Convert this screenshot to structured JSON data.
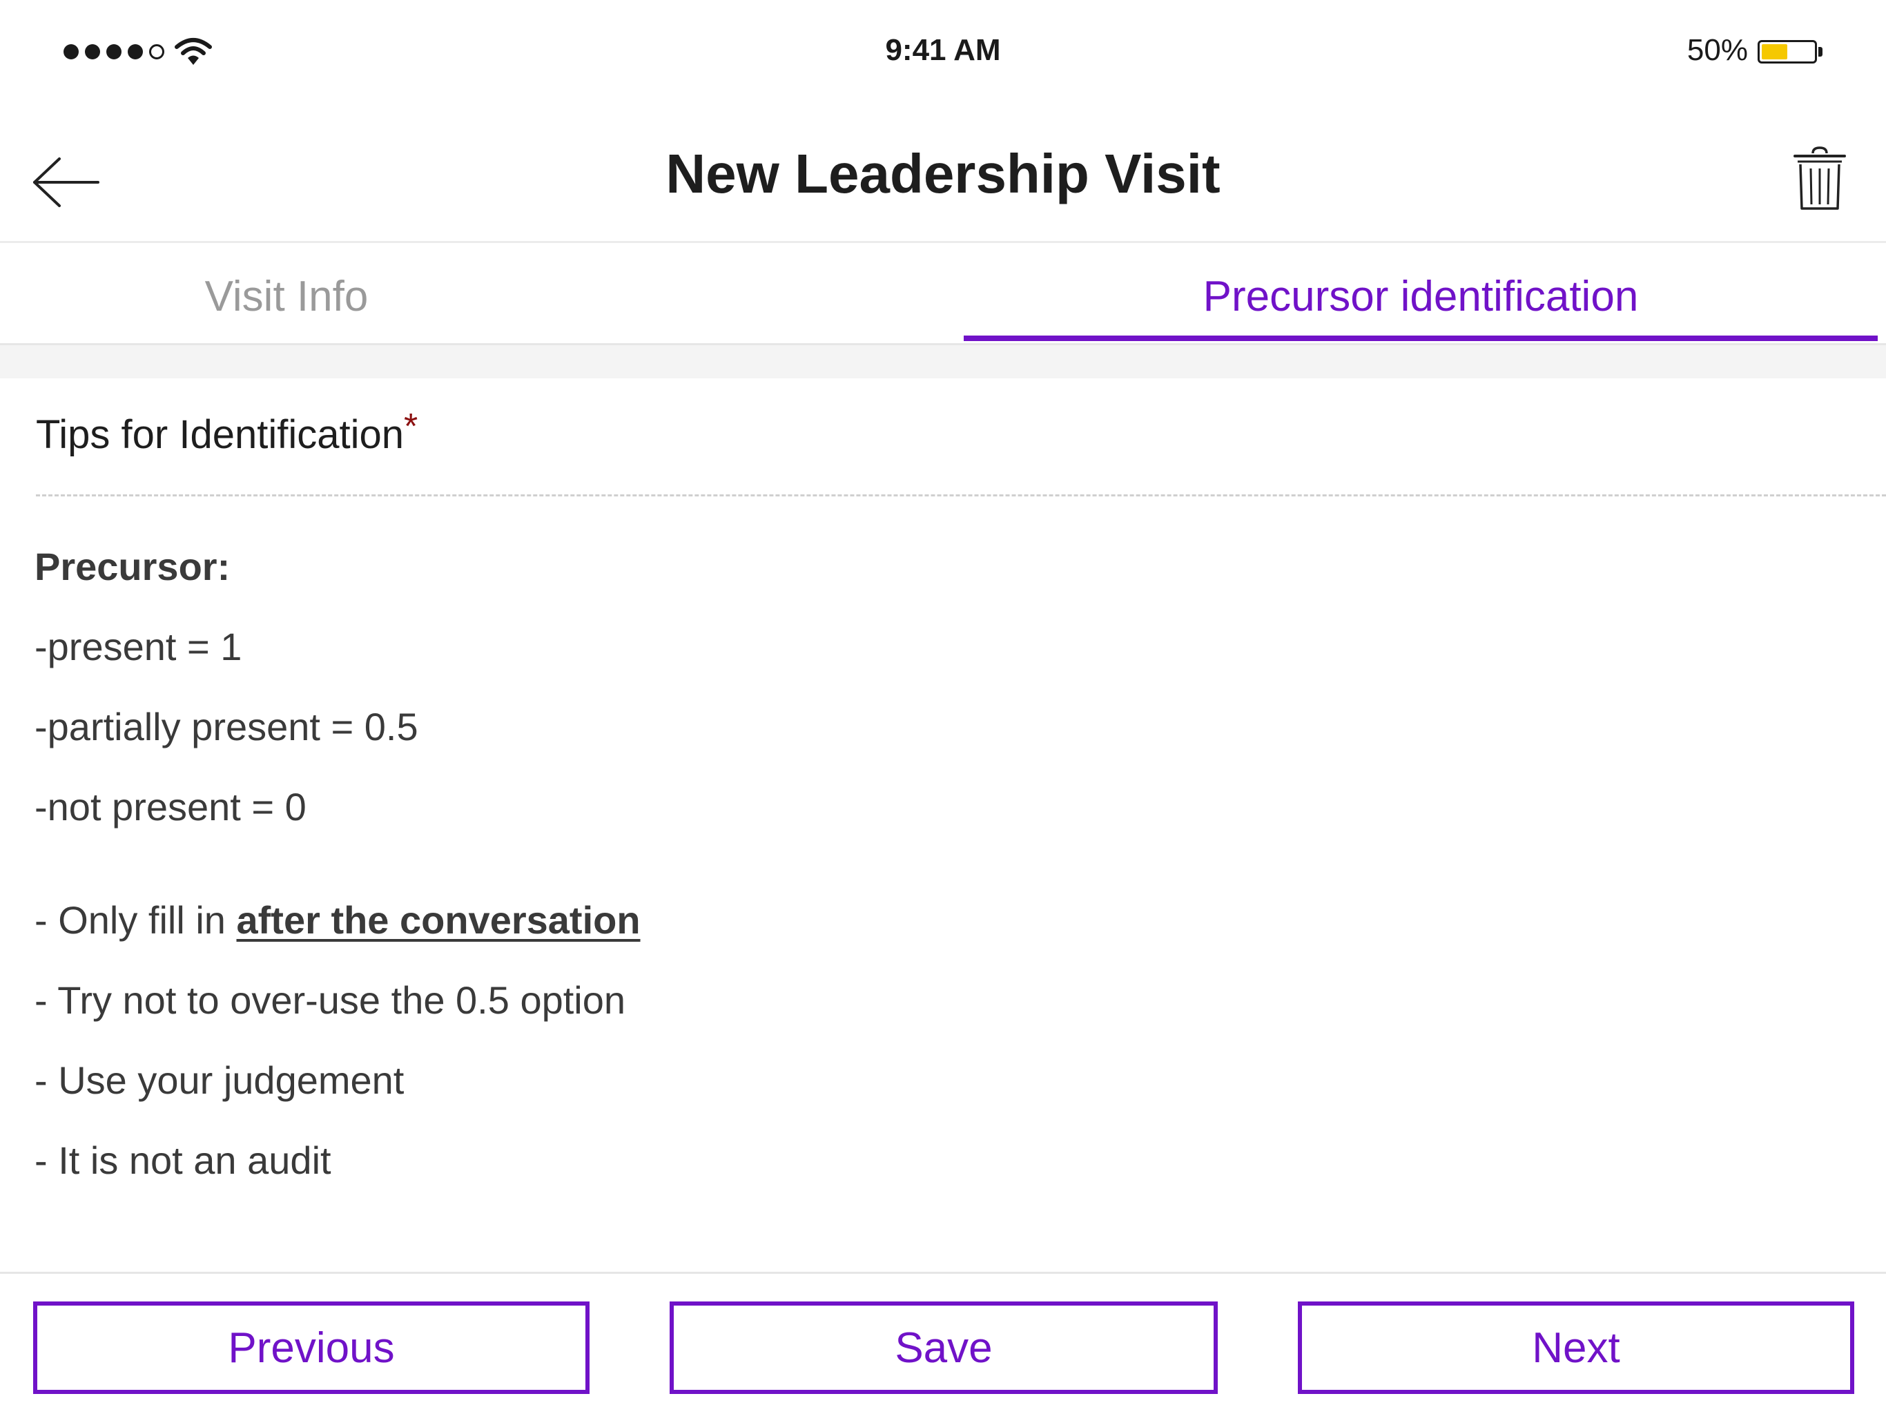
{
  "status_bar": {
    "time": "9:41 AM",
    "battery_percent": "50%",
    "battery_level": 0.5,
    "signal_bars": 4,
    "signal_max": 5
  },
  "nav": {
    "title": "New Leadership Visit",
    "back_icon": "arrow-left-icon",
    "trash_icon": "trash-icon"
  },
  "tabs": [
    {
      "label": "Visit Info",
      "active": false
    },
    {
      "label": "Precursor identification",
      "active": true
    }
  ],
  "field": {
    "label": "Tips for Identification",
    "required_mark": "*"
  },
  "tips": {
    "heading": "Precursor:",
    "scores": [
      "-present = 1",
      "-partially present = 0.5",
      "-not present = 0"
    ],
    "fill_prefix": "- Only fill in ",
    "fill_emphasis": "after the conversation",
    "notes": [
      "- Try not to over-use the 0.5 option",
      "- Use your judgement",
      "- It is not an audit"
    ]
  },
  "footer": {
    "previous_label": "Previous",
    "save_label": "Save",
    "next_label": "Next"
  },
  "colors": {
    "accent": "#7012c8",
    "required": "#8b1010",
    "battery": "#f5c800"
  }
}
